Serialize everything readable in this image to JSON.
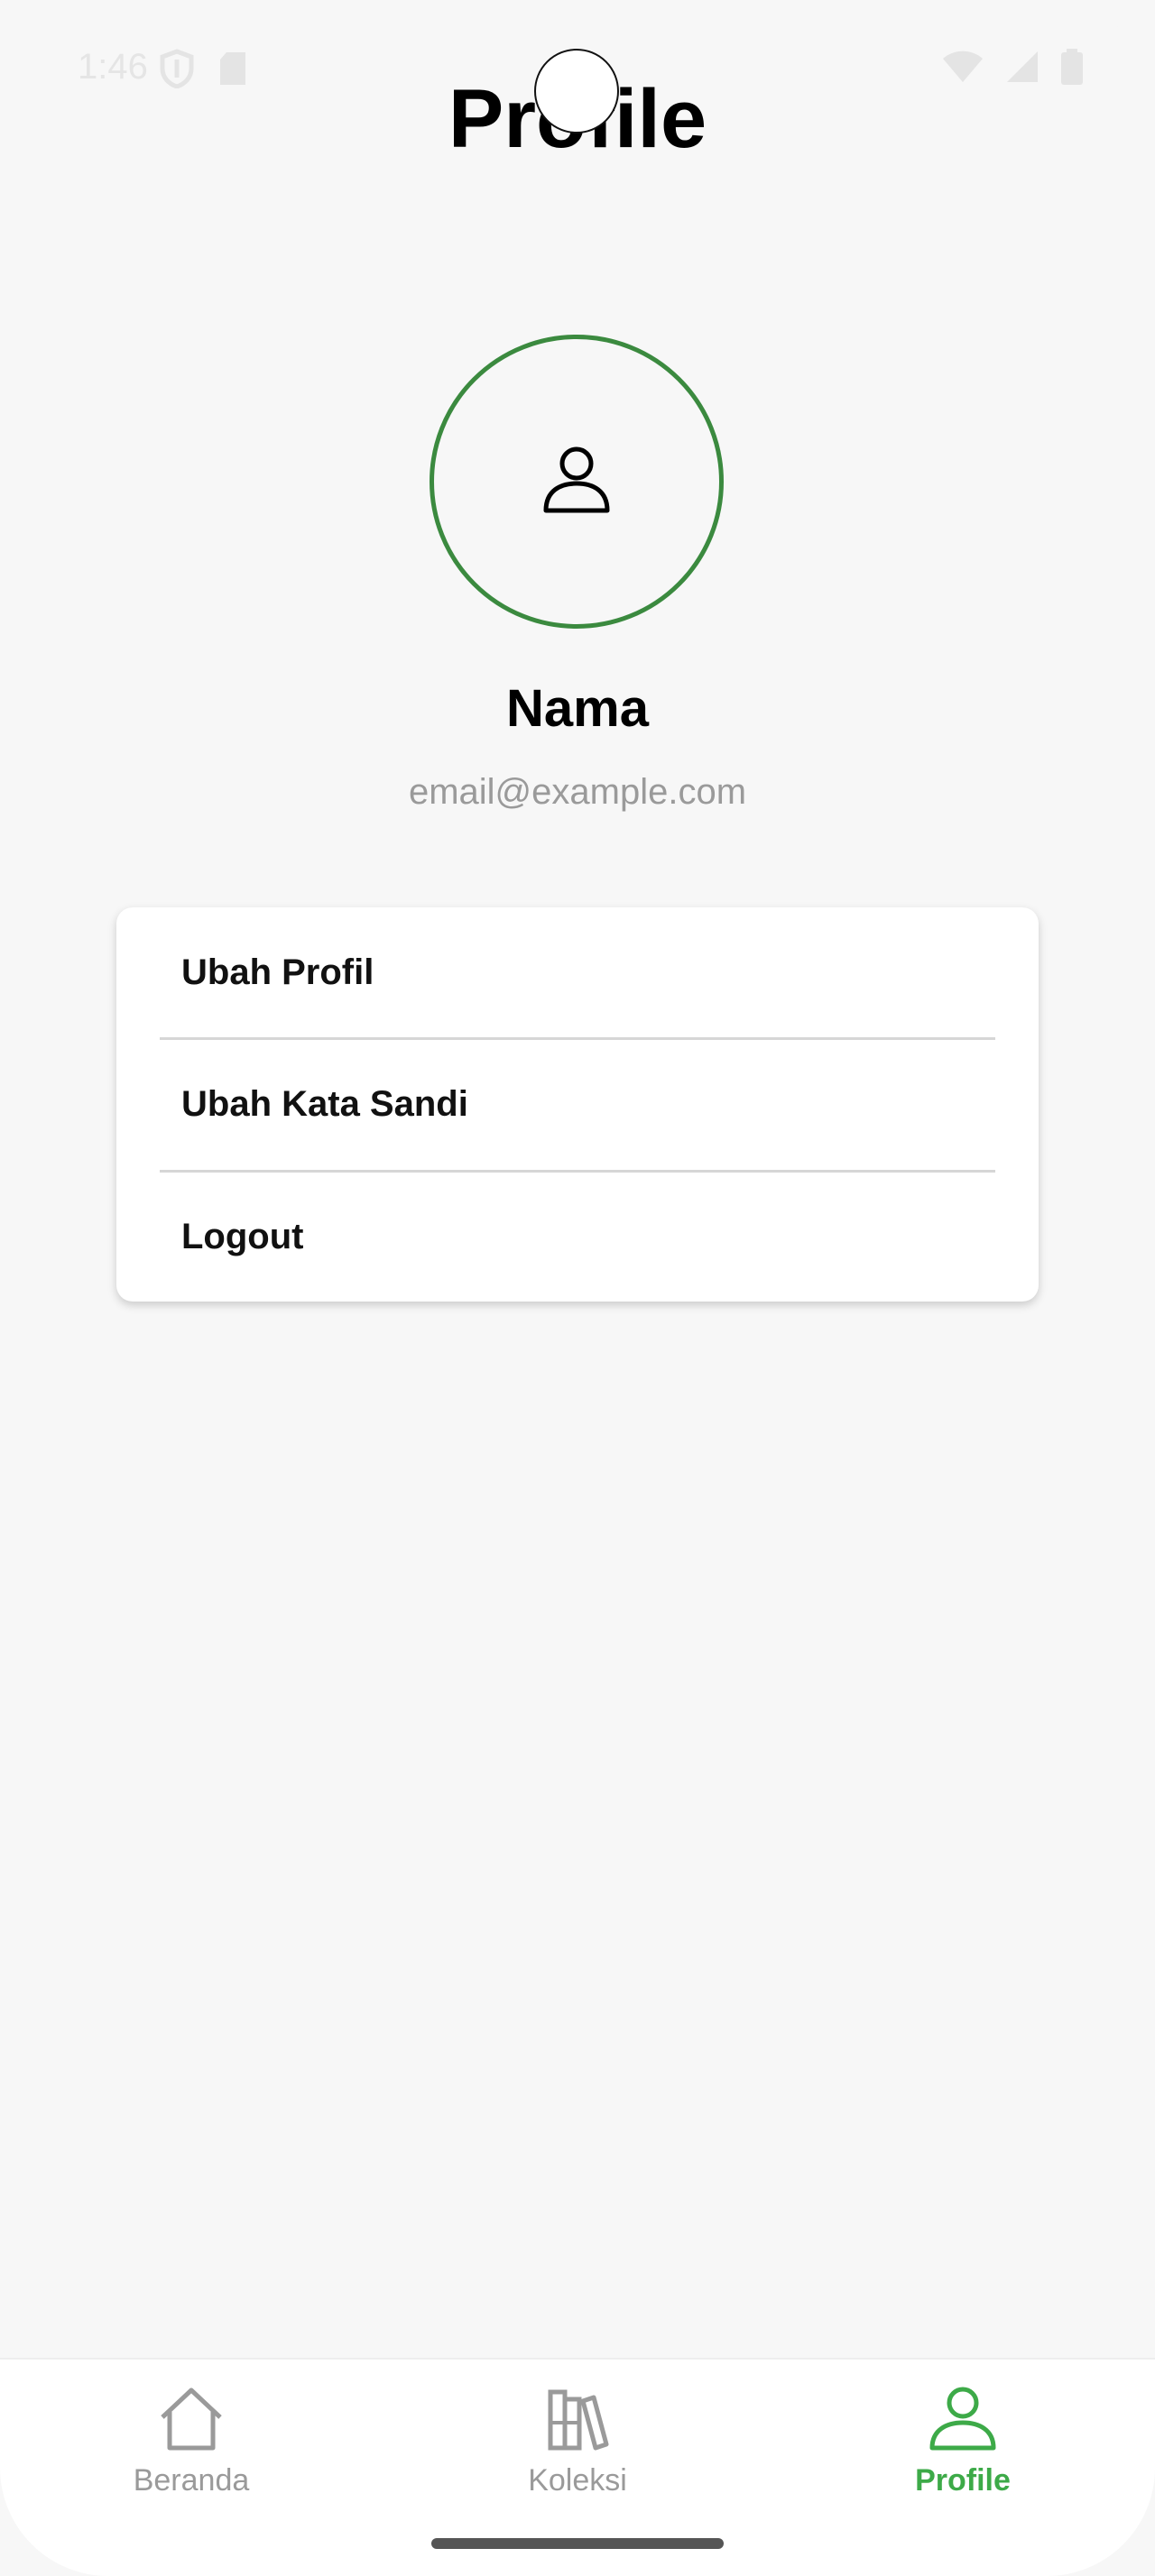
{
  "status_bar": {
    "time": "1:46",
    "icons": [
      "shield-icon",
      "sim-card-icon",
      "wifi-icon",
      "signal-icon",
      "battery-icon"
    ]
  },
  "header": {
    "title": "Profile"
  },
  "profile": {
    "avatar_icon": "person-icon",
    "name": "Nama",
    "email": "email@example.com"
  },
  "menu": {
    "items": [
      {
        "label": "Ubah Profil"
      },
      {
        "label": "Ubah Kata Sandi"
      },
      {
        "label": "Logout"
      }
    ]
  },
  "bottom_nav": {
    "items": [
      {
        "label": "Beranda",
        "icon": "home-icon",
        "active": false
      },
      {
        "label": "Koleksi",
        "icon": "books-icon",
        "active": false
      },
      {
        "label": "Profile",
        "icon": "person-icon",
        "active": true
      }
    ]
  },
  "colors": {
    "accent": "#3daa48",
    "avatar_border": "#3b8a3f",
    "inactive": "#9a9a9a",
    "background": "#f7f7f7"
  }
}
